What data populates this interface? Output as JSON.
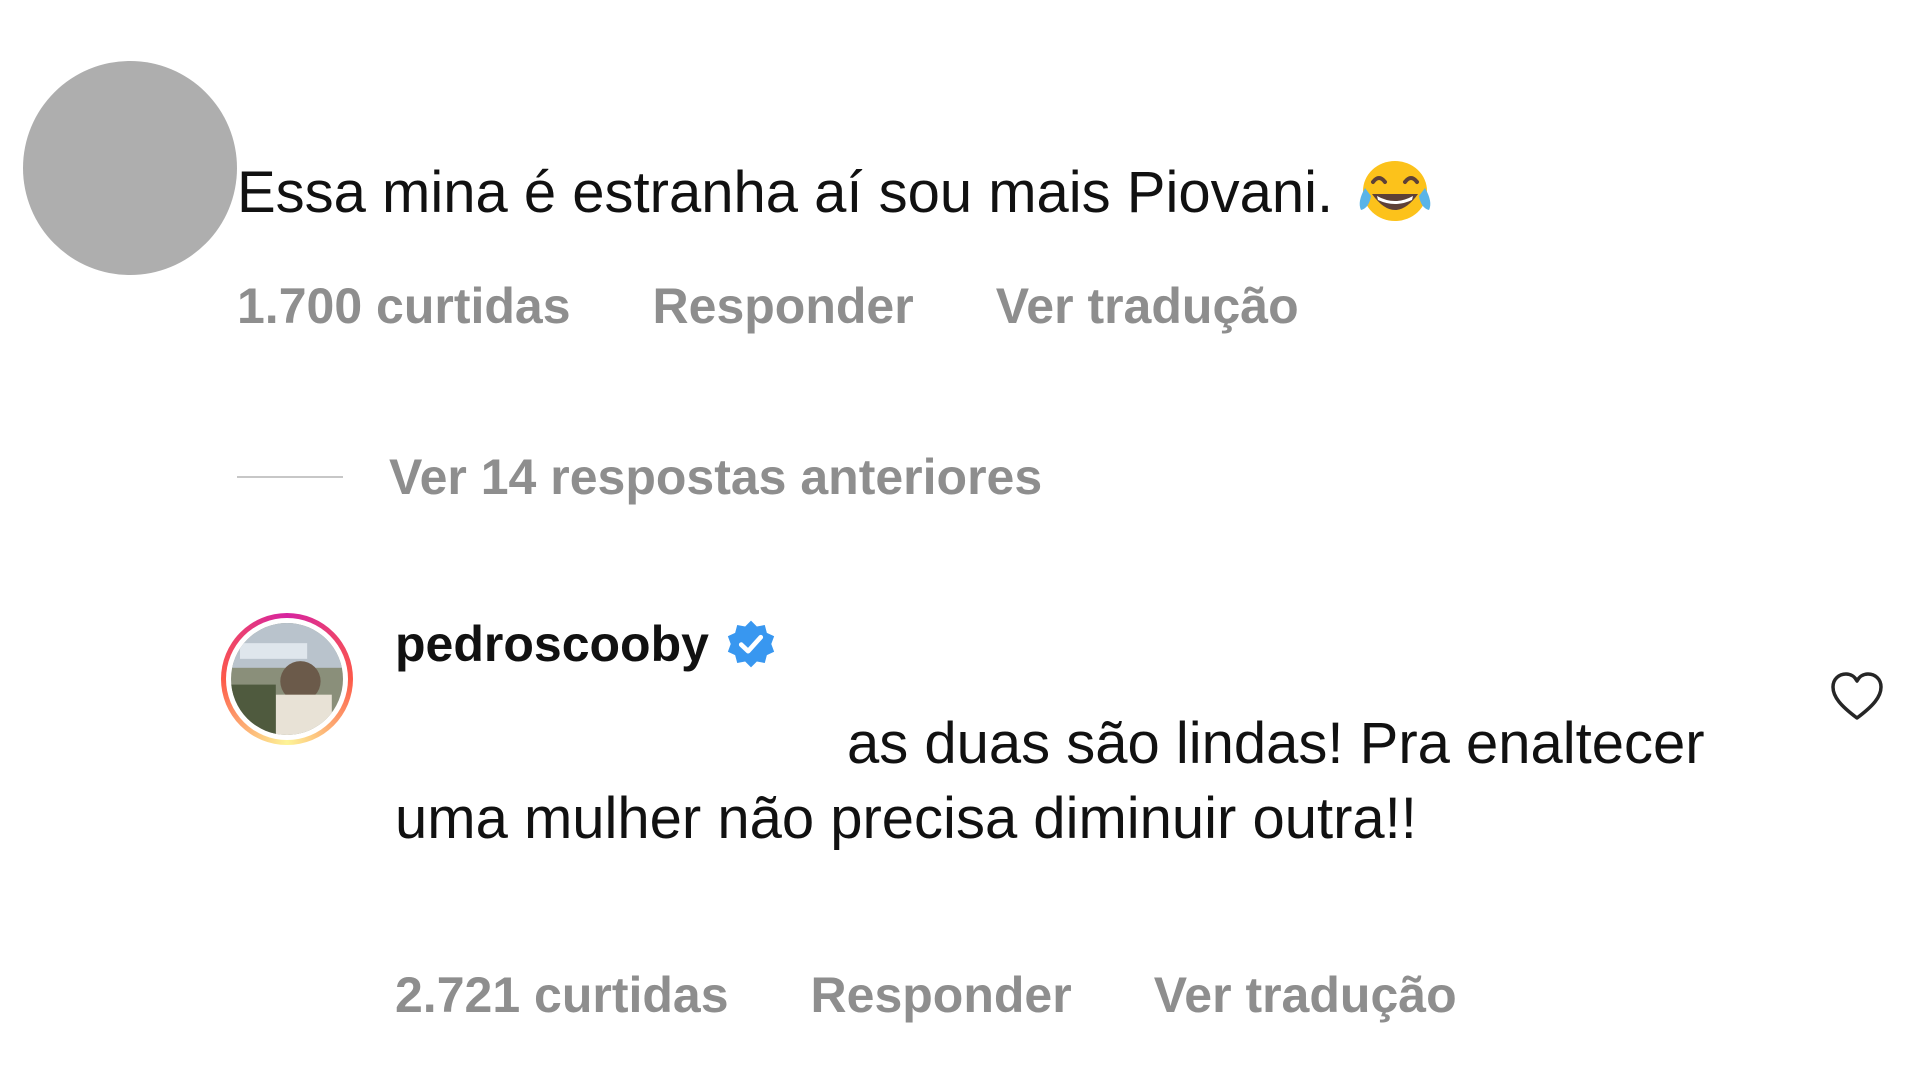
{
  "comment1": {
    "text": "Essa mina é estranha aí sou mais Piovani.",
    "emoji": "face-with-tears-of-joy",
    "likes": "1.700 curtidas",
    "reply": "Responder",
    "translate": "Ver tradução"
  },
  "view_replies": {
    "label": "Ver 14 respostas anteriores"
  },
  "comment2": {
    "username": "pedroscooby",
    "verified": true,
    "text": "as duas são lindas! Pra enaltecer uma mulher não precisa diminuir outra!!",
    "likes": "2.721 curtidas",
    "reply": "Responder",
    "translate": "Ver tradução"
  },
  "colors": {
    "meta_text": "#8e8e8e",
    "body_text": "#111111",
    "verified_blue": "#3897f0",
    "avatar_placeholder": "#aeaeae"
  }
}
